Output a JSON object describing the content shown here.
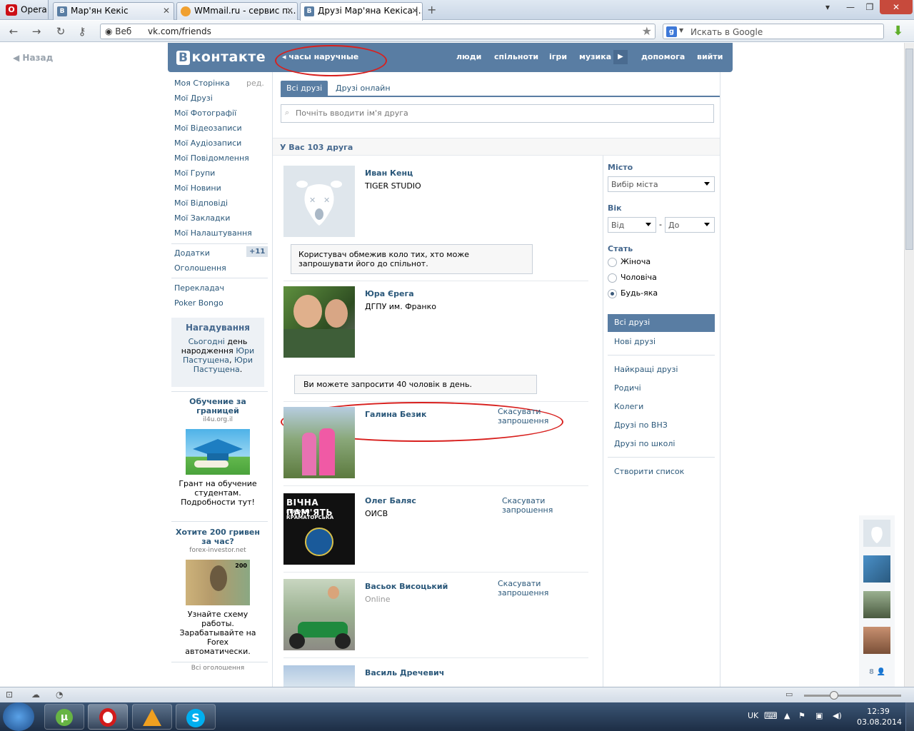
{
  "browser": {
    "menu_label": "Opera",
    "tabs": [
      {
        "label": "Мар'ян Кекіс",
        "fav": "B"
      },
      {
        "label": "WMmail.ru - сервис п...",
        "fav": "W"
      },
      {
        "label": "Друзі Мар'яна Кекіса |...",
        "fav": "B"
      }
    ],
    "address_prefix": "Веб",
    "url": "vk.com/friends",
    "search_placeholder": "Искать в Google"
  },
  "vk": {
    "back_label": "Назад",
    "logo_text": "контакте",
    "logo_letter": "В",
    "now_playing": "часы наручные",
    "topnav": [
      "люди",
      "спільноти",
      "ігри",
      "музика",
      "допомога",
      "вийти"
    ],
    "left_menu": [
      "Моя Сторінка",
      "Мої Друзі",
      "Мої Фотографії",
      "Мої Відеозаписи",
      "Мої Аудіозаписи",
      "Мої Повідомлення",
      "Мої Групи",
      "Мої Новини",
      "Мої Відповіді",
      "Мої Закладки",
      "Мої Налаштування"
    ],
    "edit_label": "ред.",
    "apps_label": "Додатки",
    "apps_badge": "+11",
    "ads_label": "Оголошення",
    "translator_label": "Перекладач",
    "poker_label": "Poker Bongo",
    "reminder": {
      "title": "Нагадування",
      "text1": "Сьогодні",
      "text2": " день народження ",
      "name1": "Юри Пастущена",
      "sep": ", ",
      "name2": "Юри Пастущена",
      "end": "."
    },
    "ad1": {
      "title": "Обучение за границей",
      "site": "il4u.org.il",
      "text": "Грант на обучение студентам. Подробности тут!"
    },
    "ad2": {
      "title": "Хотите 200 гривен за час?",
      "site": "forex-investor.net",
      "text": "Узнайте схему работы. Зарабатывайте на Forex автоматически."
    },
    "all_ads_label": "Всі оголошення",
    "tabs": [
      "Всі друзі",
      "Друзі онлайн"
    ],
    "search_placeholder": "Почніть вводити ім'я друга",
    "summary": "У Вас 103 друга",
    "friends": [
      {
        "name": "Иван Кенц",
        "sub": "TIGER STUDIO",
        "note": "Користувач обмежив коло тих, хто може запрошувати його до спільнот."
      },
      {
        "name": "Юра Єрега",
        "sub": "ДГПУ им. Франко",
        "note": "Ви можете запросити 40 чоловік в день."
      },
      {
        "name": "Галина Безик",
        "sub": "",
        "action": "Скасувати запрошення"
      },
      {
        "name": "Олег Баляс",
        "sub": "ОИСВ",
        "action": "Скасувати запрошення"
      },
      {
        "name": "Васьок Висоцький",
        "online": "Online",
        "action": "Скасувати запрошення"
      },
      {
        "name": "Василь Дречевич",
        "sub": ""
      }
    ],
    "poster_text1": "ВІЧНА ПАМ'ЯТЬ",
    "poster_text2": "ГЕРОЯМ КРАМАТОРСЬКА",
    "filter": {
      "city_label": "Місто",
      "city_value": "Вибір міста",
      "age_label": "Вік",
      "age_from": "Від",
      "age_dash": "-",
      "age_to": "До",
      "sex_label": "Стать",
      "sex_options": [
        "Жіноча",
        "Чоловіча",
        "Будь-яка"
      ],
      "menu": [
        "Всі друзі",
        "Нові друзі",
        "Найкращі друзі",
        "Родичі",
        "Колеги",
        "Друзі по ВНЗ",
        "Друзі по школі",
        "Створити список"
      ]
    },
    "online_count": "8"
  },
  "taskbar": {
    "lang": "UK",
    "time": "12:39",
    "date": "03.08.2014"
  },
  "colors": {
    "vk_blue": "#597da3",
    "link": "#2b587a",
    "annotation_red": "#d8201e"
  }
}
